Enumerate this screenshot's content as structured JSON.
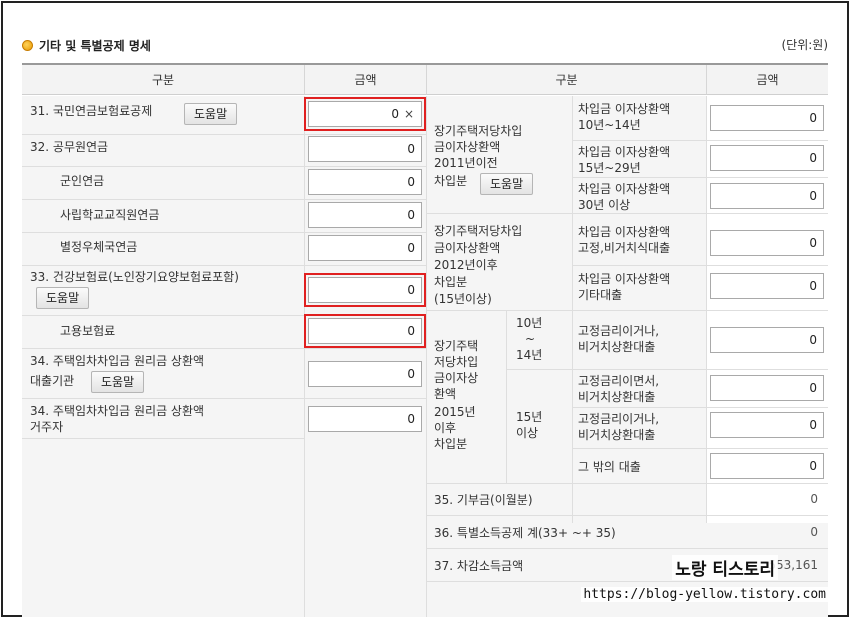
{
  "header": {
    "title": "기타 및 특별공제 명세",
    "unit": "(단위:원)"
  },
  "columns": {
    "left_category": "구분",
    "left_amount": "금액",
    "right_category": "구분",
    "right_amount": "금액"
  },
  "help_label": "도움말",
  "left_rows": [
    {
      "label": "31. 국민연금보험료공제",
      "value": "0"
    },
    {
      "label": "32. 공무원연금",
      "value": "0"
    },
    {
      "label": "군인연금",
      "value": "0"
    },
    {
      "label": "사립학교교직원연금",
      "value": "0"
    },
    {
      "label": "별정우체국연금",
      "value": "0"
    },
    {
      "label": "33. 건강보험료(노인장기요양보험료포함)",
      "value": "0"
    },
    {
      "label": "고용보험료",
      "value": "0"
    },
    {
      "label1": "34. 주택임차차입금 원리금 상환액",
      "label2": "대출기관",
      "value": "0"
    },
    {
      "label1": "34. 주택임차차입금 원리금 상환액",
      "label2": "거주자",
      "value": "0"
    }
  ],
  "clear_symbol": "×",
  "right_groups": {
    "g2011": {
      "lines": [
        "장기주택저당차입",
        "금이자상환액",
        "2011년이전",
        "차입분"
      ]
    },
    "g2012": {
      "lines": [
        "장기주택저당차입",
        "금이자상환액",
        "2012년이후",
        "차입분",
        "(15년이상)"
      ]
    },
    "g2015": {
      "lines": [
        "장기주택",
        "저당차입",
        "금이자상",
        "환액",
        "2015년",
        "이후",
        "차입분"
      ]
    },
    "p10": {
      "lines": [
        "10년",
        "~",
        "14년"
      ]
    },
    "p15": {
      "lines": [
        "15년",
        "이상"
      ]
    }
  },
  "right_rows": [
    {
      "lines": [
        "차입금 이자상환액",
        "10년~14년"
      ],
      "value": "0"
    },
    {
      "lines": [
        "차입금 이자상환액",
        "15년~29년"
      ],
      "value": "0"
    },
    {
      "lines": [
        "차입금 이자상환액",
        "30년 이상"
      ],
      "value": "0"
    },
    {
      "lines": [
        "차입금 이자상환액",
        "고정,비거치식대출"
      ],
      "value": "0"
    },
    {
      "lines": [
        "차입금 이자상환액",
        "기타대출"
      ],
      "value": "0"
    },
    {
      "lines": [
        "고정금리이거나,",
        "비거치상환대출"
      ],
      "value": "0"
    },
    {
      "lines": [
        "고정금리이면서,",
        "비거치상환대출"
      ],
      "value": "0"
    },
    {
      "lines": [
        "고정금리이거나,",
        "비거치상환대출"
      ],
      "value": "0"
    },
    {
      "lines": [
        "그 밖의 대출"
      ],
      "value": "0"
    }
  ],
  "summary_rows": [
    {
      "label": "35. 기부금(이월분)",
      "value": "0"
    },
    {
      "label": "36. 특별소득공제 계(33+ ~+ 35)",
      "value": "0"
    },
    {
      "label": "37. 차감소득금액",
      "value": "553,161"
    }
  ],
  "watermark": "노랑 티스토리",
  "url": "https://blog-yellow.tistory.com"
}
